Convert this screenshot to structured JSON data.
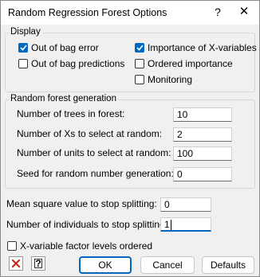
{
  "window": {
    "title": "Random Regression Forest Options",
    "help_glyph": "?",
    "close_glyph": "✕"
  },
  "display": {
    "label": "Display",
    "options": [
      {
        "label": "Out of bag error",
        "checked": true
      },
      {
        "label": "Out of bag predictions",
        "checked": false
      },
      {
        "label": "Importance of X-variables",
        "checked": true
      },
      {
        "label": "Ordered importance",
        "checked": false
      },
      {
        "label": "Monitoring",
        "checked": false
      }
    ]
  },
  "generation": {
    "label": "Random forest generation",
    "fields": [
      {
        "label": "Number of trees in forest:",
        "value": "10"
      },
      {
        "label": "Number of Xs to select at random:",
        "value": "2"
      },
      {
        "label": "Number of units to select at random:",
        "value": "100"
      },
      {
        "label": "Seed for random number generation:",
        "value": "0"
      }
    ]
  },
  "stopping": {
    "mean_square_label": "Mean square value to stop splitting:",
    "mean_square_value": "0",
    "individuals_label": "Number of individuals to stop splitting:",
    "individuals_value": "1"
  },
  "factor_levels": {
    "label": "X-variable factor levels ordered",
    "checked": false
  },
  "buttons": {
    "ok": "OK",
    "cancel": "Cancel",
    "defaults": "Defaults",
    "delete_icon": "x-icon",
    "help_icon": "help-icon"
  },
  "colors": {
    "accent": "#0067c0",
    "delete_red": "#c42b1c"
  }
}
